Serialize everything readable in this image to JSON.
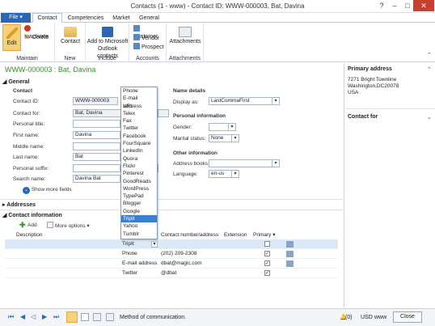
{
  "window": {
    "title": "Contacts (1 - www) - Contact ID: WWW-000003, Bat, Davina"
  },
  "tabs": {
    "file": "File ▾",
    "contact": "Contact",
    "competencies": "Competencies",
    "market": "Market",
    "general": "General"
  },
  "ribbon": {
    "edit": "Edit",
    "inactivate": "Inactivate",
    "delete": "Delete",
    "maintain": "Maintain",
    "contact": "Contact",
    "new": "New",
    "add_outlook": "Add to Microsoft",
    "add_outlook2": "Outlook contacts",
    "include": "Include",
    "customer": "Customer",
    "vendor": "Vendor",
    "prospect": "Prospect",
    "accounts": "Accounts",
    "attachments": "Attachments",
    "attachments_group": "Attachments"
  },
  "header": "WWW-000003 : Bat, Davina",
  "general": {
    "title": "General",
    "contact_title": "Contact",
    "contact_id_label": "Contact ID:",
    "contact_id": "WWW-000003",
    "contact_for_label": "Contact for:",
    "contact_for": "Bat, Davina",
    "personal_title_label": "Personal title:",
    "first_name_label": "First name:",
    "first_name": "Davina",
    "middle_name_label": "Middle name:",
    "last_name_label": "Last name:",
    "last_name": "Bat",
    "personal_suffix_label": "Personal suffix:",
    "search_name_label": "Search name:",
    "search_name": "Davina Bat",
    "show_more": "Show more fields",
    "name_details": "Name details",
    "display_as_label": "Display as:",
    "display_as": "LastCommaFirst",
    "personal_info": "Personal information",
    "gender_label": "Gender:",
    "marital_label": "Marital status:",
    "marital": "None",
    "other_info": "Other information",
    "address_books_label": "Address books:",
    "language_label": "Language:",
    "language": "en-us"
  },
  "addresses": "Addresses",
  "contact_information": {
    "title": "Contact information",
    "add": "Add",
    "more": "More options ▾",
    "col_description": "Description",
    "col_contact": "Contact number/address",
    "col_extension": "Extension",
    "col_primary": "Primary",
    "rows": [
      {
        "type": "TripIt",
        "value": "",
        "primary": ""
      },
      {
        "type": "Phone",
        "value": "(202) 209-2308",
        "primary": "✓"
      },
      {
        "type": "E-mail address",
        "value": "dbat@magic.com",
        "primary": "✓"
      },
      {
        "type": "Twitter",
        "value": "@dbat",
        "primary": "✓"
      }
    ]
  },
  "dropdown": [
    "Phone",
    "E-mail address",
    "URL",
    "Telex",
    "Fax",
    "Twitter",
    "Facebook",
    "FourSquare",
    "LinkedIn",
    "Quora",
    "Flickr",
    "Pinterest",
    "GoodReads",
    "WordPress",
    "TypePad",
    "Blogger",
    "Google",
    "TripIt",
    "Yahoo",
    "Tumblr"
  ],
  "factbox": {
    "primary_address": "Primary address",
    "addr1": "7271 Bright Townline",
    "addr2": "Washington,DC20078",
    "addr3": "USA",
    "contact_for": "Contact for"
  },
  "status": {
    "message": "Method of communication.",
    "currency": "USD",
    "company": "www",
    "close": "Close"
  }
}
